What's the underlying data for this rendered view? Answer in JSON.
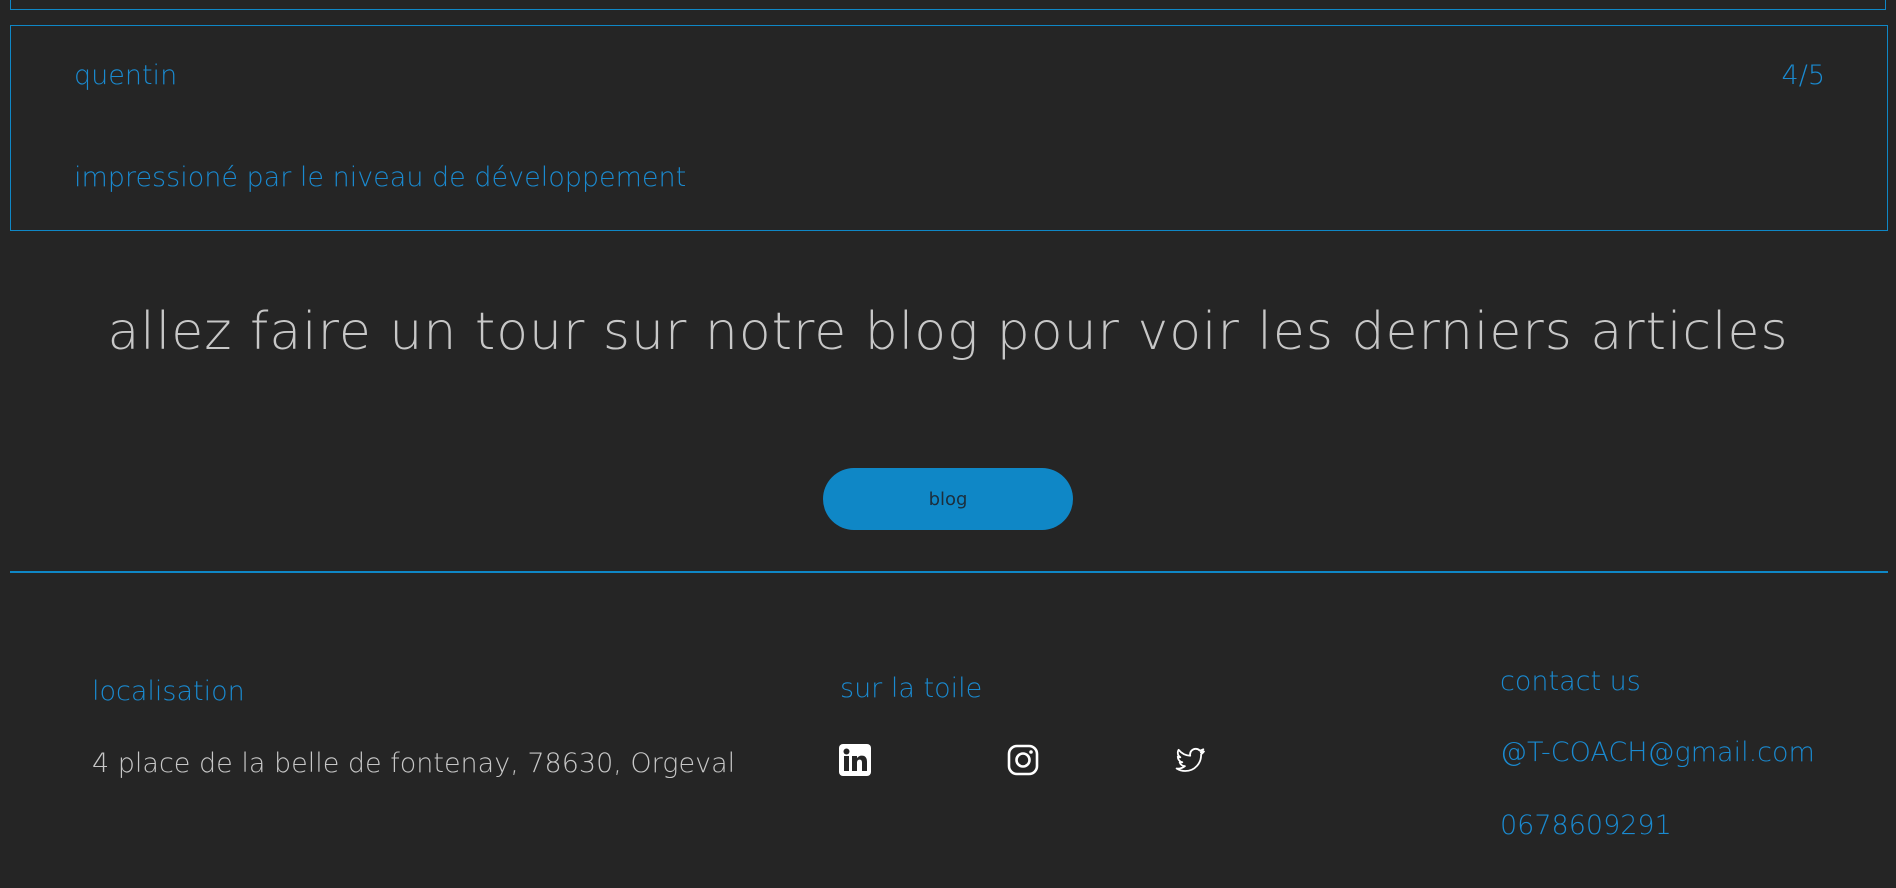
{
  "review": {
    "name": "quentin",
    "rating": "4/5",
    "comment": "impressioné par le niveau de développement"
  },
  "blog_promo": {
    "heading": "allez faire un tour sur notre blog pour voir les derniers articles",
    "button_label": "blog"
  },
  "footer": {
    "location": {
      "title": "localisation",
      "address": "4 place de la belle de fontenay, 78630, Orgeval"
    },
    "social": {
      "title": "sur la toile",
      "icons": [
        "linkedin-icon",
        "instagram-icon",
        "twitter-icon"
      ]
    },
    "contact": {
      "title": "contact us",
      "email": "@T-COACH@gmail.com",
      "phone": "0678609291"
    }
  },
  "colors": {
    "background": "#252525",
    "accent": "#0f87c6",
    "text_light": "#c7c7c7"
  }
}
